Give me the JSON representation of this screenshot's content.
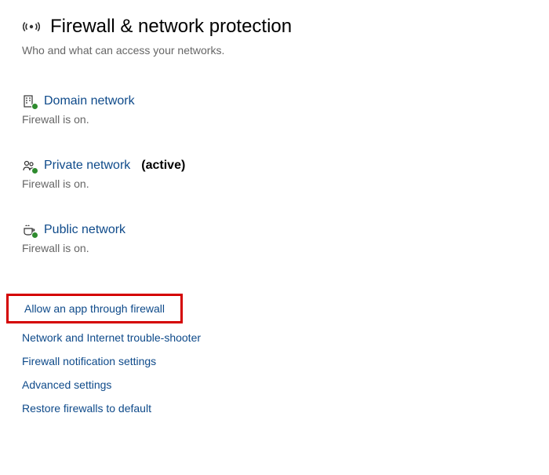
{
  "header": {
    "title": "Firewall & network protection",
    "subtitle": "Who and what can access your networks."
  },
  "networks": {
    "domain": {
      "name": "Domain network",
      "status": "Firewall is on.",
      "active": false
    },
    "private": {
      "name": "Private network",
      "active_label": "(active)",
      "status": "Firewall is on.",
      "active": true
    },
    "public": {
      "name": "Public network",
      "status": "Firewall is on.",
      "active": false
    }
  },
  "links": {
    "allow_app": "Allow an app through firewall",
    "troubleshoot": "Network and Internet trouble-shooter",
    "notifications": "Firewall notification settings",
    "advanced": "Advanced settings",
    "restore": "Restore firewalls to default"
  }
}
